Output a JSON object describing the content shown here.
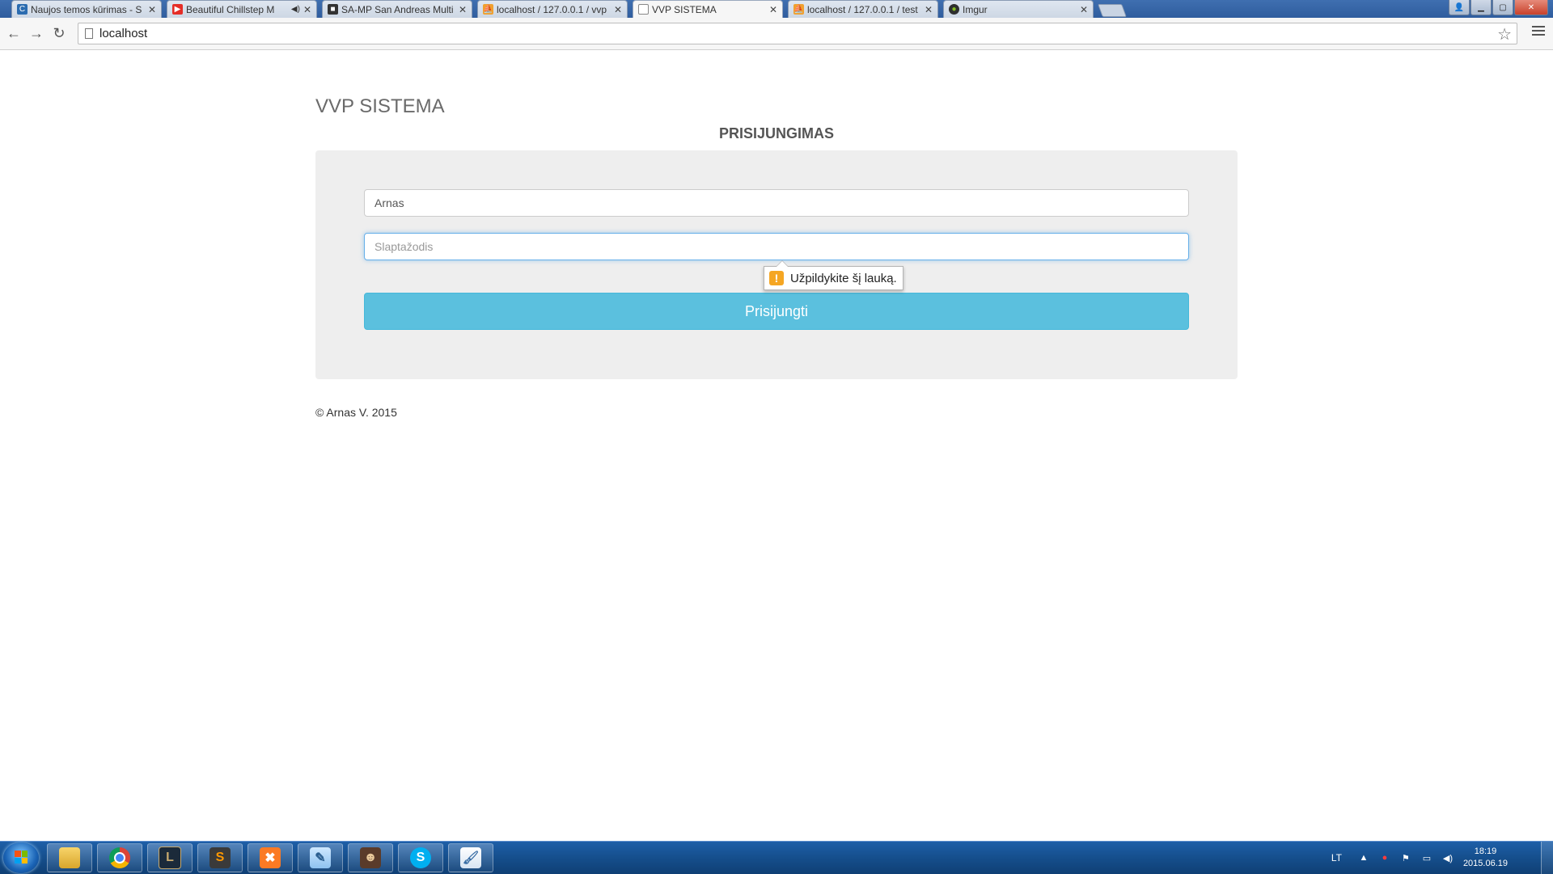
{
  "browser": {
    "tabs": [
      {
        "title": "Naujos temos kūrimas - S",
        "favicon": "c-icon"
      },
      {
        "title": "Beautiful Chillstep M",
        "favicon": "youtube-icon"
      },
      {
        "title": "SA-MP San Andreas Multi",
        "favicon": "samp-icon"
      },
      {
        "title": "localhost / 127.0.0.1 / vvp",
        "favicon": "pma-icon"
      },
      {
        "title": "VVP SISTEMA",
        "favicon": "page-icon"
      },
      {
        "title": "localhost / 127.0.0.1 / test",
        "favicon": "pma-icon"
      },
      {
        "title": "Imgur",
        "favicon": "imgur-icon"
      }
    ],
    "address": "localhost"
  },
  "page": {
    "title": "VVP SISTEMA",
    "form_heading": "PRISIJUNGIMAS",
    "username_value": "Arnas",
    "password_placeholder": "Slaptažodis",
    "validation_message": "Užpildykite šį lauką.",
    "submit_label": "Prisijungti",
    "footer": "© Arnas V. 2015"
  },
  "taskbar": {
    "apps": [
      "explorer",
      "chrome",
      "league-of-legends",
      "sublime-text",
      "xampp",
      "notepad",
      "samp-game",
      "skype",
      "paint"
    ],
    "language": "LT",
    "time": "18:19",
    "date": "2015.06.19"
  },
  "colors": {
    "button": "#5bc0de",
    "panel": "#eeeeee",
    "focus_border": "#66afe9",
    "warning": "#f5a623",
    "taskbar": "#16508f"
  }
}
